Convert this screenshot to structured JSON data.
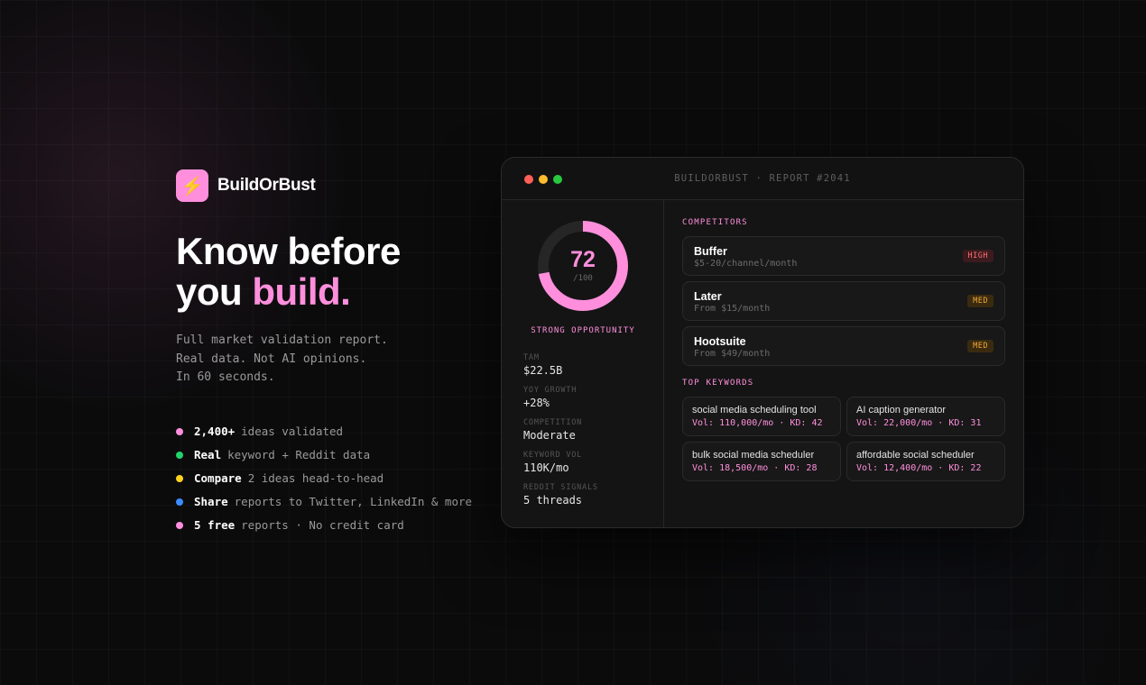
{
  "colors": {
    "accent": "#ff8fdc",
    "bg": "#0b0b0c",
    "panel": "#141414"
  },
  "brand": {
    "icon": "lightning-icon",
    "icon_glyph": "⚡",
    "name": "BuildOrBust"
  },
  "headline": {
    "line1": "Know before",
    "line2_prefix": "you ",
    "line2_accent": "build."
  },
  "subtitle": [
    "Full market validation report.",
    "Real data. Not AI opinions.",
    "In 60 seconds."
  ],
  "features": [
    {
      "bold": "2,400+",
      "text": "ideas validated",
      "dot_color": "#ff8fdc"
    },
    {
      "bold": "Real",
      "text": "keyword + Reddit data",
      "dot_color": "#22d36b"
    },
    {
      "bold": "Compare",
      "text": "2 ideas head-to-head",
      "dot_color": "#ffd21e"
    },
    {
      "bold": "Share",
      "text": "reports to Twitter, LinkedIn & more",
      "dot_color": "#3b8cff"
    },
    {
      "bold": "5 free",
      "text": "reports · No credit card",
      "dot_color": "#ff8fdc"
    }
  ],
  "report": {
    "title": "BUILDORBUST · REPORT #2041",
    "traffic_lights": [
      "#ff5f57",
      "#febc2e",
      "#28c840"
    ],
    "score": {
      "value": 72,
      "max_label": "/100",
      "fraction": 0.72,
      "verdict": "STRONG OPPORTUNITY"
    },
    "stats": [
      {
        "label": "TAM",
        "value": "$22.5B"
      },
      {
        "label": "YOY GROWTH",
        "value": "+28%"
      },
      {
        "label": "COMPETITION",
        "value": "Moderate"
      },
      {
        "label": "KEYWORD VOL",
        "value": "110K/mo"
      },
      {
        "label": "REDDIT SIGNALS",
        "value": "5 threads"
      }
    ],
    "competitors_title": "COMPETITORS",
    "competitors": [
      {
        "name": "Buffer",
        "price": "$5-20/channel/month",
        "level": "HIGH"
      },
      {
        "name": "Later",
        "price": "From $15/month",
        "level": "MED"
      },
      {
        "name": "Hootsuite",
        "price": "From $49/month",
        "level": "MED"
      }
    ],
    "keywords_title": "TOP KEYWORDS",
    "keywords": [
      {
        "term": "social media scheduling tool",
        "stats": "Vol: 110,000/mo · KD: 42"
      },
      {
        "term": "AI caption generator",
        "stats": "Vol: 22,000/mo · KD: 31"
      },
      {
        "term": "bulk social media scheduler",
        "stats": "Vol: 18,500/mo · KD: 28"
      },
      {
        "term": "affordable social scheduler",
        "stats": "Vol: 12,400/mo · KD: 22"
      }
    ]
  }
}
